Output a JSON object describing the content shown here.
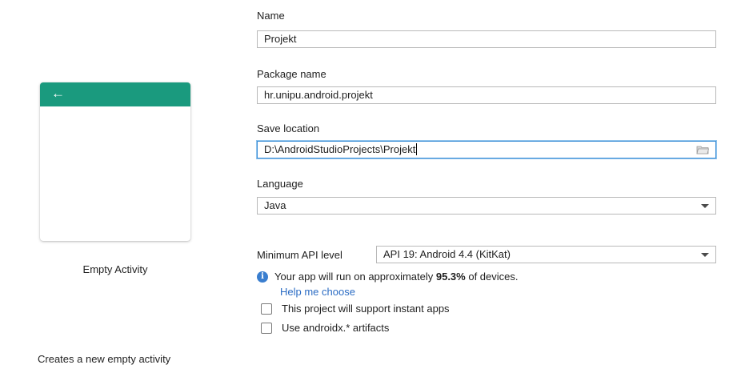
{
  "template": {
    "name": "Empty Activity",
    "description": "Creates a new empty activity",
    "back_glyph": "←"
  },
  "form": {
    "name_label": "Name",
    "name_value": "Projekt",
    "package_label": "Package name",
    "package_value": "hr.unipu.android.projekt",
    "save_label": "Save location",
    "save_value": "D:\\AndroidStudioProjects\\Projekt",
    "language_label": "Language",
    "language_value": "Java",
    "min_api_label": "Minimum API level",
    "min_api_value": "API 19: Android 4.4 (KitKat)",
    "info_prefix": "Your app will run on approximately ",
    "info_percent": "95.3%",
    "info_suffix": " of devices.",
    "help_link": "Help me choose",
    "instant_apps_label": "This project will support instant apps",
    "androidx_label": "Use androidx.* artifacts"
  },
  "colors": {
    "card_bar": "#1a9a7e",
    "link": "#2b6cc4",
    "info_icon": "#3a7ecf"
  },
  "icons": [
    "back-arrow-icon",
    "folder-icon",
    "chevron-down-icon",
    "info-icon"
  ]
}
